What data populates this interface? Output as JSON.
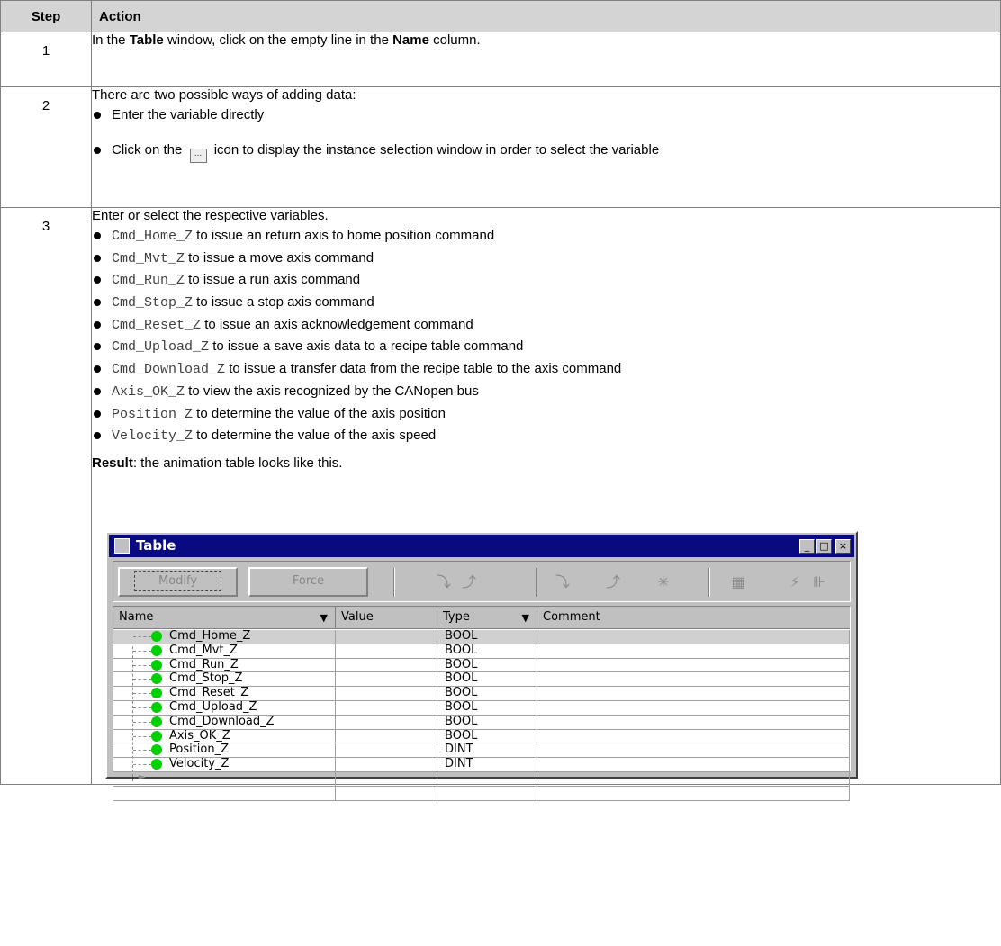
{
  "headers": {
    "step": "Step",
    "action": "Action"
  },
  "row1": {
    "step": "1",
    "t1": "In the ",
    "b1": "Table",
    "t2": " window, click on the empty line in the ",
    "b2": "Name",
    "t3": " column."
  },
  "row2": {
    "step": "2",
    "intro": "There are two possible ways of adding data:",
    "bullet1": "Enter the variable directly",
    "bullet2_a": "Click on the",
    "bullet2_icon": "...",
    "bullet2_b": "icon to display the instance selection window in order to select the variable"
  },
  "row3": {
    "step": "3",
    "intro": "Enter or select the respective variables.",
    "vars": [
      {
        "code": "Cmd_Home_Z",
        "desc": " to issue an return axis to home position command"
      },
      {
        "code": "Cmd_Mvt_Z",
        "desc": " to issue a move axis command"
      },
      {
        "code": "Cmd_Run_Z",
        "desc": " to issue a run axis command"
      },
      {
        "code": "Cmd_Stop_Z",
        "desc": " to issue a stop axis command"
      },
      {
        "code": "Cmd_Reset_Z",
        "desc": " to issue an axis acknowledgement command"
      },
      {
        "code": "Cmd_Upload_Z",
        "desc": " to issue a save axis data to a recipe table command"
      },
      {
        "code": "Cmd_Download_Z",
        "desc": " to issue a transfer data from the recipe table to the axis command"
      },
      {
        "code": "Axis_OK_Z",
        "desc": " to view the axis recognized by the CANopen bus"
      },
      {
        "code": "Position_Z",
        "desc": " to determine the value of the axis position"
      },
      {
        "code": "Velocity_Z",
        "desc": " to determine the value of the axis speed"
      }
    ],
    "result_bold": "Result",
    "result_text": ": the animation table looks like this."
  },
  "window": {
    "title": "Table",
    "modify": "Modify",
    "force": "Force",
    "columns": {
      "name": "Name",
      "value": "Value",
      "type": "Type",
      "comment": "Comment"
    },
    "rows": [
      {
        "name": "Cmd_Home_Z",
        "value": "",
        "type": "BOOL",
        "comment": ""
      },
      {
        "name": "Cmd_Mvt_Z",
        "value": "",
        "type": "BOOL",
        "comment": ""
      },
      {
        "name": "Cmd_Run_Z",
        "value": "",
        "type": "BOOL",
        "comment": ""
      },
      {
        "name": "Cmd_Stop_Z",
        "value": "",
        "type": "BOOL",
        "comment": ""
      },
      {
        "name": "Cmd_Reset_Z",
        "value": "",
        "type": "BOOL",
        "comment": ""
      },
      {
        "name": "Cmd_Upload_Z",
        "value": "",
        "type": "BOOL",
        "comment": ""
      },
      {
        "name": "Cmd_Download_Z",
        "value": "",
        "type": "BOOL",
        "comment": ""
      },
      {
        "name": "Axis_OK_Z",
        "value": "",
        "type": "BOOL",
        "comment": ""
      },
      {
        "name": "Position_Z",
        "value": "",
        "type": "DINT",
        "comment": ""
      },
      {
        "name": "Velocity_Z",
        "value": "",
        "type": "DINT",
        "comment": ""
      }
    ]
  }
}
